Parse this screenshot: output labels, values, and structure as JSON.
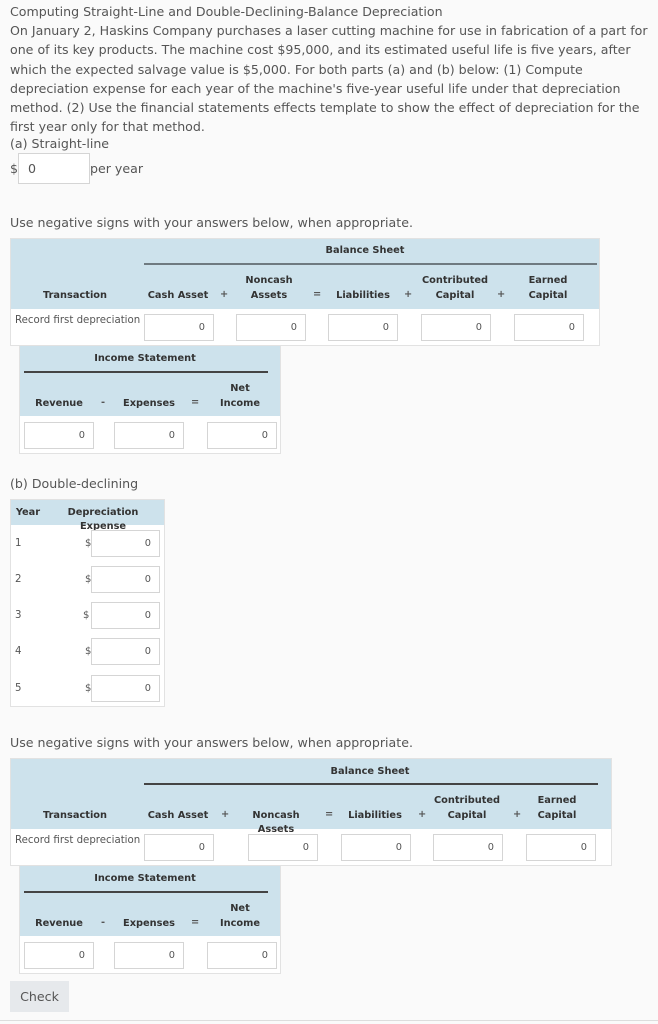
{
  "problem": {
    "title": "Computing Straight-Line and Double-Declining-Balance Depreciation",
    "body": "On January 2, Haskins Company purchases a laser cutting machine for use in fabrication of a part for one of its key products. The machine cost $95,000, and its estimated useful life is five years, after which the expected salvage value is $5,000. For both parts (a) and (b) below: (1) Compute depreciation expense for each year of the machine's five-year useful life under that depreciation method. (2) Use the financial statements effects template to show the effect of depreciation for the first year only for that method."
  },
  "part_a": {
    "label": "(a) Straight-line",
    "currency": "$",
    "value": "0",
    "suffix": "per year"
  },
  "instruction": "Use negative signs with your answers below, when appropriate.",
  "template1": {
    "balance_sheet_title": "Balance Sheet",
    "income_statement_title": "Income Statement",
    "headers": {
      "transaction": "Transaction",
      "cash_asset": "Cash Asset",
      "noncash_1": "Noncash",
      "noncash_2": "Assets",
      "liabilities": "Liabilities",
      "contributed_1": "Contributed",
      "contributed_2": "Capital",
      "earned_1": "Earned",
      "earned_2": "Capital",
      "revenue": "Revenue",
      "expenses": "Expenses",
      "net_1": "Net",
      "net_2": "Income"
    },
    "ops": {
      "plus": "+",
      "equals": "=",
      "minus": "-"
    },
    "row_label": "Record first depreciation",
    "values": {
      "cash_asset": "0",
      "noncash_assets": "0",
      "liabilities": "0",
      "contributed_capital": "0",
      "earned_capital": "0",
      "revenue": "0",
      "expenses": "0",
      "net_income": "0"
    }
  },
  "part_b": {
    "label": "(b) Double-declining",
    "headers": {
      "year": "Year",
      "expense": "Depreciation Expense"
    },
    "currency": "$",
    "rows": [
      {
        "year": "1",
        "value": "0"
      },
      {
        "year": "2",
        "value": "0"
      },
      {
        "year": "3",
        "value": "0"
      },
      {
        "year": "4",
        "value": "0"
      },
      {
        "year": "5",
        "value": "0"
      }
    ]
  },
  "instruction2": "Use negative signs with your answers below, when appropriate.",
  "template2": {
    "balance_sheet_title": "Balance Sheet",
    "income_statement_title": "Income Statement",
    "headers": {
      "transaction": "Transaction",
      "cash_asset": "Cash Asset",
      "noncash": "Noncash Assets",
      "liabilities": "Liabilities",
      "contributed_1": "Contributed",
      "contributed_2": "Capital",
      "earned_1": "Earned",
      "earned_2": "Capital",
      "revenue": "Revenue",
      "expenses": "Expenses",
      "net_1": "Net",
      "net_2": "Income"
    },
    "ops": {
      "plus": "+",
      "equals": "=",
      "minus": "-"
    },
    "row_label": "Record first depreciation",
    "values": {
      "cash_asset": "0",
      "noncash_assets": "0",
      "liabilities": "0",
      "contributed_capital": "0",
      "earned_capital": "0",
      "revenue": "0",
      "expenses": "0",
      "net_income": "0"
    }
  },
  "check_button": "Check"
}
